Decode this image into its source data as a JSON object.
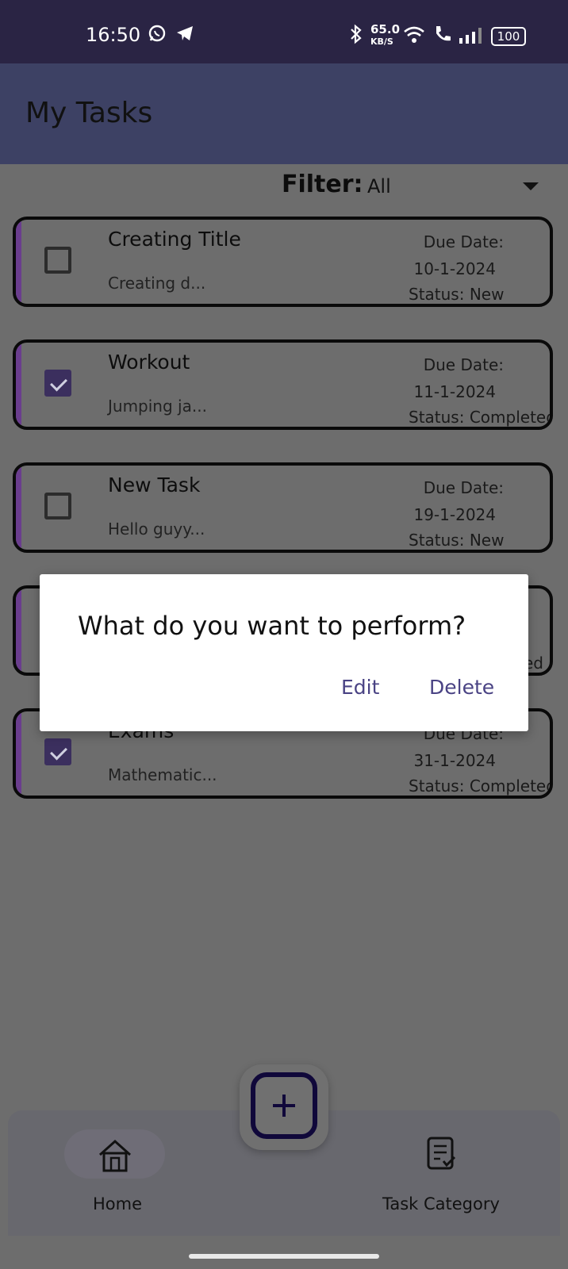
{
  "status_bar": {
    "time": "16:50",
    "net_speed": "65.0",
    "net_unit": "KB/S",
    "battery": "100"
  },
  "appbar": {
    "title": "My Tasks"
  },
  "filter": {
    "label": "Filter:",
    "value": "All"
  },
  "tasks": [
    {
      "title": "Creating Title",
      "desc": "Creating d...",
      "due_label": "Due Date:",
      "date": "10-1-2024",
      "status": "Status: New",
      "checked": false
    },
    {
      "title": "Workout",
      "desc": "Jumping ja...",
      "due_label": "Due Date:",
      "date": "11-1-2024",
      "status": "Status: Completed",
      "checked": true
    },
    {
      "title": "New Task",
      "desc": "Hello guyy...",
      "due_label": "Due Date:",
      "date": "19-1-2024",
      "status": "Status: New",
      "checked": false
    },
    {
      "title": "",
      "desc": "",
      "due_label": "",
      "date": "",
      "status": "ed",
      "checked": false
    },
    {
      "title": "Exams",
      "desc": "Mathematic...",
      "due_label": "Due Date:",
      "date": "31-1-2024",
      "status": "Status: Completed",
      "checked": true
    }
  ],
  "dialog": {
    "question": "What do you want to perform?",
    "edit": "Edit",
    "delete": "Delete"
  },
  "bottom_nav": {
    "home": "Home",
    "category": "Task Category"
  },
  "colors": {
    "statusbar": "#2a2444",
    "appbar": "#3d4164",
    "accent": "#4a4384",
    "stripe": "#6a3d8e"
  }
}
